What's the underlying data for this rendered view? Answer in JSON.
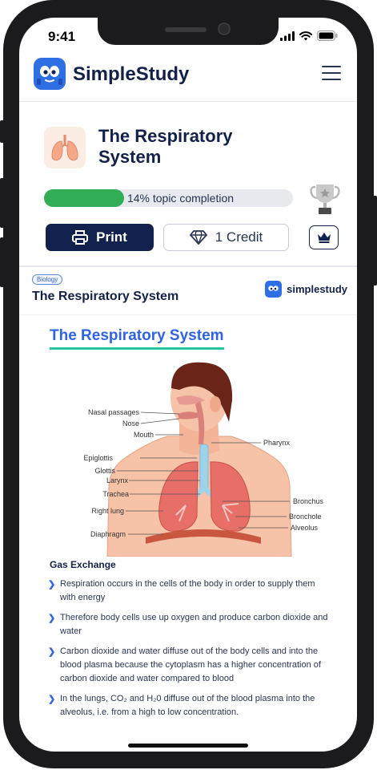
{
  "status": {
    "time": "9:41"
  },
  "header": {
    "brand": "SimpleStudy"
  },
  "topic": {
    "title": "The Respiratory System",
    "progress_fraction": 0.14,
    "progress_label": "14% topic completion",
    "print_label": "Print",
    "credit_label": "1 Credit"
  },
  "document": {
    "badge": "Biology",
    "title": "The Respiratory System",
    "logo_text": "simplestudy"
  },
  "content": {
    "heading": "The Respiratory System",
    "diagram_labels": {
      "nasal": "Nasal passages",
      "nose": "Nose",
      "mouth": "Mouth",
      "epiglottis": "Epiglottis",
      "glottis": "Glottis",
      "larynx": "Larynx",
      "trachea": "Trachea",
      "right_lung": "Right lung",
      "diaphragm": "Diaphragm",
      "pharynx": "Pharynx",
      "bronchus": "Bronchus",
      "bronchiole": "Bronchole",
      "alveolus": "Alveolus"
    },
    "section_heading": "Gas Exchange",
    "bullets": [
      "Respiration occurs in the cells of the body in order to supply them with energy",
      "Therefore body cells use up oxygen and produce carbon dioxide and water",
      "Carbon dioxide and water diffuse out of the body cells and into the blood plasma because the cytoplasm has a higher concentration of carbon dioxide and water compared to blood",
      "In the lungs, CO₂ and H₂0 diffuse out of the blood plasma into the alveolus, i.e. from a high to low concentration."
    ]
  },
  "colors": {
    "brand_navy": "#13214a",
    "brand_blue": "#2f6fe4",
    "progress_green": "#30ad55",
    "heading_underline": "#27c4a0"
  },
  "icons": [
    "signal-icon",
    "wifi-icon",
    "battery-icon",
    "menu-icon",
    "lungs-icon",
    "trophy-icon",
    "printer-icon",
    "diamond-icon",
    "crown-icon",
    "chevron-right-icon"
  ]
}
